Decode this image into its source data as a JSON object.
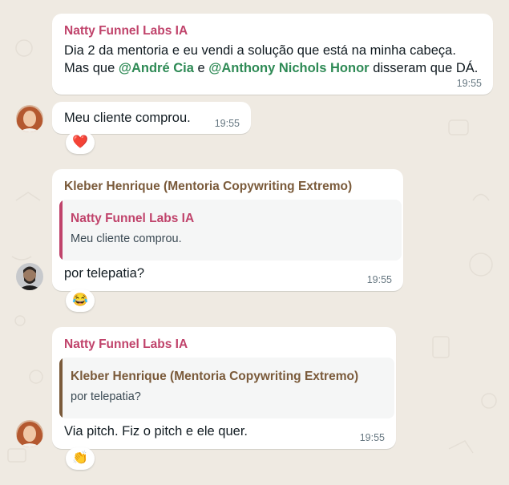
{
  "theme": {
    "chat_bg": "#efeae2",
    "bubble_bg": "#ffffff",
    "accent_pink": "#c0436b",
    "accent_brown": "#7a5a3a",
    "mention_green": "#2e8a55"
  },
  "messages": [
    {
      "sender": "Natty Funnel Labs IA",
      "line1": "Dia 2 da mentoria e eu vendi a solução que está na minha cabeça.",
      "line2_prefix": "Mas que ",
      "mention1": "@André Cia",
      "line2_mid": " e ",
      "mention2": "@Anthony Nichols Honor",
      "line2_suffix": " disseram que DÁ.",
      "time": "19:55"
    },
    {
      "text": "Meu cliente comprou.",
      "time": "19:55",
      "reaction": "❤️",
      "reaction_icon": "heart-icon"
    },
    {
      "sender": "Kleber Henrique (Mentoria Copywriting Extremo)",
      "quote": {
        "sender": "Natty Funnel Labs IA",
        "text": "Meu cliente comprou."
      },
      "text": "por telepatia?",
      "time": "19:55",
      "reaction": "😂",
      "reaction_icon": "laughing-emoji-icon"
    },
    {
      "sender": "Natty Funnel Labs IA",
      "quote": {
        "sender": "Kleber Henrique (Mentoria Copywriting Extremo)",
        "text": "por telepatia?"
      },
      "text": "Via pitch. Fiz o pitch e ele quer.",
      "time": "19:55",
      "reaction": "👏",
      "reaction_icon": "clapping-hands-icon"
    }
  ]
}
